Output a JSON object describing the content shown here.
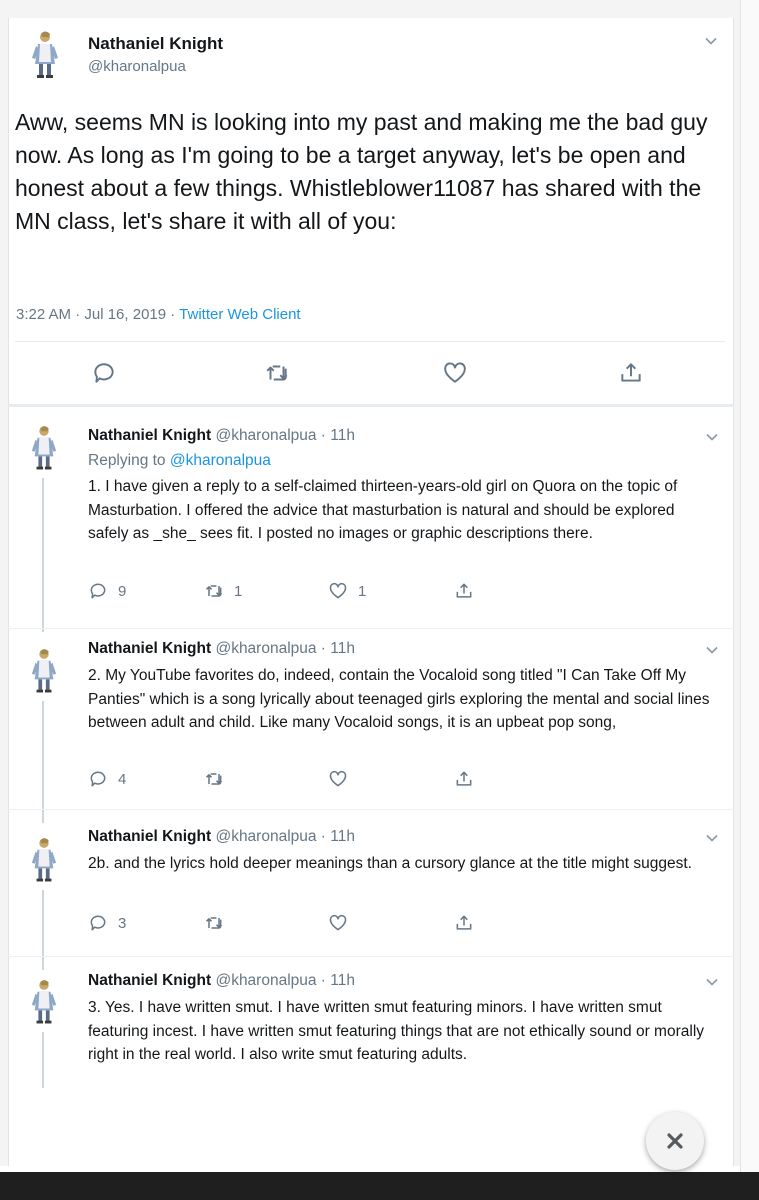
{
  "main_tweet": {
    "name": "Nathaniel Knight",
    "handle": "@kharonalpua",
    "text": "Aww, seems MN is looking into my past and making me the bad guy now. As long as I'm going to be a target anyway, let's be open and honest about a few things. Whistleblower11087 has shared with the MN class, let's share it with all of you:",
    "time": "3:22 AM · Jul 16, 2019 · ",
    "client": "Twitter Web Client",
    "actions": [
      "reply-icon",
      "retweet-icon",
      "like-icon",
      "share-icon"
    ]
  },
  "replies": [
    {
      "name": "Nathaniel Knight",
      "handle": "@kharonalpua · 11h",
      "replying_prefix": "Replying to ",
      "replying_mention": "@kharonalpua",
      "text": "1. I have given a reply to a self-claimed thirteen-years-old girl on Quora on the topic of Masturbation. I offered the advice that masturbation is natural and should be explored safely as _she_ sees fit. I posted no images or graphic descriptions there.",
      "reply_count": "9",
      "retweet_count": "1",
      "like_count": "1"
    },
    {
      "name": "Nathaniel Knight",
      "handle": "@kharonalpua · 11h",
      "text": "2. My YouTube favorites do, indeed, contain the Vocaloid song titled \"I Can Take Off My Panties\" which is a song lyrically about teenaged girls exploring the mental and social lines between adult and child. Like many Vocaloid songs, it is an upbeat pop song,",
      "reply_count": "4",
      "retweet_count": "",
      "like_count": ""
    },
    {
      "name": "Nathaniel Knight",
      "handle": "@kharonalpua · 11h",
      "text": "2b. and the lyrics hold deeper meanings than a cursory glance at the title might suggest.",
      "reply_count": "3",
      "retweet_count": "",
      "like_count": ""
    },
    {
      "name": "Nathaniel Knight",
      "handle": "@kharonalpua · 11h",
      "text": "3. Yes. I have written smut. I have written smut featuring minors. I have written smut featuring incest. I have written smut featuring things that are not ethically sound or morally right in the real world. I also write smut featuring adults."
    }
  ],
  "overlay": {
    "close_icon": "close-icon"
  },
  "colors": {
    "link": "#1b95e0",
    "muted": "#657786",
    "text": "#14171a"
  }
}
